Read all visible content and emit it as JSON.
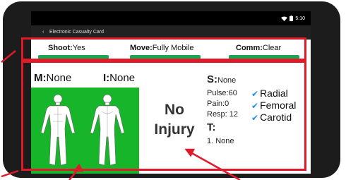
{
  "status_bar": {
    "time": "5:10",
    "wifi_icon": "wifi-icon",
    "battery_icon": "battery-icon"
  },
  "app_bar": {
    "title": "Electronic Casualty Card",
    "back_icon": "back-arrow-icon"
  },
  "top_stats": {
    "shoot": {
      "label": "Shoot:",
      "value": "Yes"
    },
    "move": {
      "label": "Move:",
      "value": "Fully Mobile"
    },
    "comm": {
      "label": "Comm:",
      "value": "Clear"
    },
    "bar_color": "#19a84f"
  },
  "massive_hemorrhage": {
    "label": "M:",
    "value": "None"
  },
  "interventions": {
    "label": "I:",
    "value": "None"
  },
  "body_panel": {
    "color": "#16b52a",
    "figure_icons": [
      "body-front-icon",
      "body-back-icon"
    ]
  },
  "injury_status": {
    "line1": "No",
    "line2": "Injury"
  },
  "vitals": {
    "s_label": "S:",
    "s_value": "None",
    "pulse": "Pulse:60",
    "pain": "Pain:0",
    "resp": "Resp: 12",
    "t_label": "T:",
    "t_value": "1. None"
  },
  "pulse_sites": [
    {
      "label": "Radial",
      "checked": true
    },
    {
      "label": "Femoral",
      "checked": true
    },
    {
      "label": "Carotid",
      "checked": true
    }
  ],
  "annotation_color": "#e0192b"
}
